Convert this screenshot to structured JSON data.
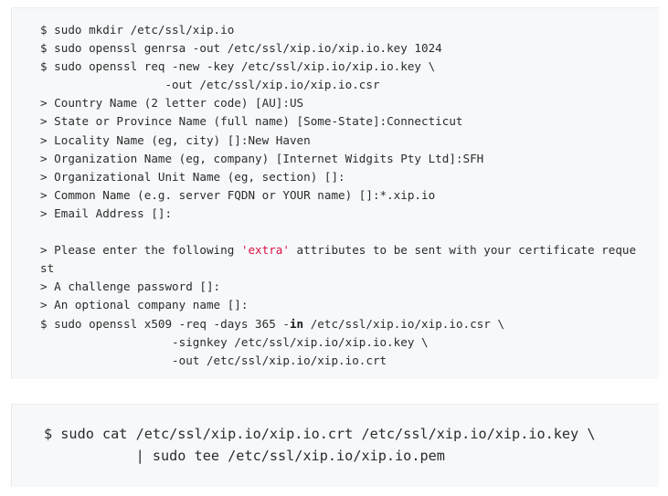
{
  "block1": {
    "lines": [
      [
        {
          "t": "$ sudo mkdir /etc/ssl/xip.io"
        }
      ],
      [
        {
          "t": "$ sudo openssl genrsa -out /etc/ssl/xip.io/xip.io.key 1024"
        }
      ],
      [
        {
          "t": "$ sudo openssl req -new -key /etc/ssl/xip.io/xip.io.key \\"
        }
      ],
      [
        {
          "t": "                  -out /etc/ssl/xip.io/xip.io.csr"
        }
      ],
      [
        {
          "t": "> Country Name (2 letter code) [AU]:US"
        }
      ],
      [
        {
          "t": "> State or Province Name (full name) [Some-State]:Connecticut"
        }
      ],
      [
        {
          "t": "> Locality Name (eg, city) []:New Haven"
        }
      ],
      [
        {
          "t": "> Organization Name (eg, company) [Internet Widgits Pty Ltd]:SFH"
        }
      ],
      [
        {
          "t": "> Organizational Unit Name (eg, section) []:"
        }
      ],
      [
        {
          "t": "> Common Name (e.g. server FQDN or YOUR name) []:*.xip.io"
        }
      ],
      [
        {
          "t": "> Email Address []:"
        }
      ],
      [
        {
          "t": ""
        }
      ],
      [
        {
          "t": "> Please enter the following "
        },
        {
          "t": "'extra'",
          "c": "str"
        },
        {
          "t": " attributes to be sent with your certificate reque"
        }
      ],
      [
        {
          "t": "st"
        }
      ],
      [
        {
          "t": "> A challenge password []:"
        }
      ],
      [
        {
          "t": "> An optional company name []:"
        }
      ],
      [
        {
          "t": "$ sudo openssl x509 -req -days 365 -"
        },
        {
          "t": "in",
          "c": "kw"
        },
        {
          "t": " /etc/ssl/xip.io/xip.io.csr \\"
        }
      ],
      [
        {
          "t": "                   -signkey /etc/ssl/xip.io/xip.io.key \\"
        }
      ],
      [
        {
          "t": "                   -out /etc/ssl/xip.io/xip.io.crt"
        }
      ]
    ]
  },
  "block2": {
    "lines": [
      [
        {
          "t": "$ sudo cat /etc/ssl/xip.io/xip.io.crt /etc/ssl/xip.io/xip.io.key \\"
        }
      ],
      [
        {
          "t": "           | sudo tee /etc/ssl/xip.io/xip.io.pem"
        }
      ]
    ]
  },
  "colors": {
    "background": "#f6f8fa",
    "text": "#2b2b2b",
    "string": "#dd1144"
  }
}
